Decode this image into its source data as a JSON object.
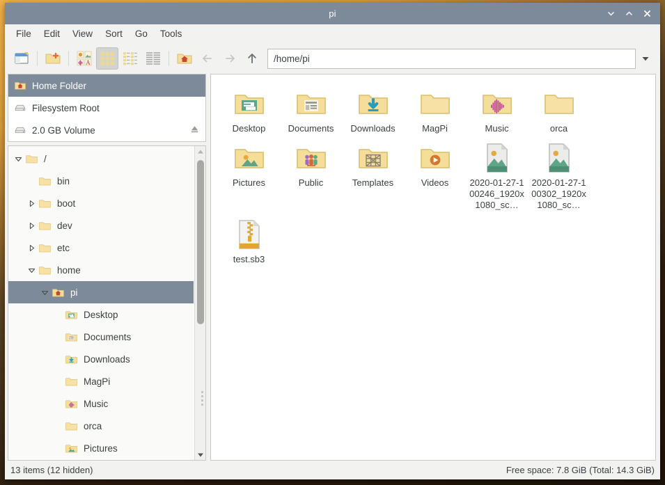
{
  "window": {
    "title": "pi",
    "buttons": [
      {
        "name": "minimize",
        "glyph": "chevron-down"
      },
      {
        "name": "maximize",
        "glyph": "chevron-up"
      },
      {
        "name": "close",
        "glyph": "x"
      }
    ]
  },
  "menubar": {
    "items": [
      "File",
      "Edit",
      "View",
      "Sort",
      "Go",
      "Tools"
    ]
  },
  "toolbar": {
    "buttons": [
      {
        "name": "new-tab-button",
        "icon": "new-tab-icon",
        "active": false
      },
      {
        "name": "new-folder-button",
        "icon": "new-folder-icon",
        "active": false
      },
      {
        "name": "view-icons-thumbnail-button",
        "icon": "thumbnail-view-icon",
        "active": false
      },
      {
        "name": "view-icons-button",
        "icon": "icon-view-icon",
        "active": true
      },
      {
        "name": "view-compact-button",
        "icon": "compact-view-icon",
        "active": false
      },
      {
        "name": "view-detailed-button",
        "icon": "detailed-view-icon",
        "active": false
      },
      {
        "name": "home-button",
        "icon": "home-folder-icon",
        "active": false
      }
    ],
    "nav": [
      {
        "name": "back-button",
        "icon": "arrow-left-icon",
        "enabled": false
      },
      {
        "name": "forward-button",
        "icon": "arrow-right-icon",
        "enabled": false
      },
      {
        "name": "up-button",
        "icon": "arrow-up-icon",
        "enabled": true
      }
    ],
    "path_value": "/home/pi",
    "path_placeholder": "",
    "path_dropdown_icon": "triangle-down-icon"
  },
  "sidebar": {
    "places": [
      {
        "label": "Home Folder",
        "icon": "home-folder-icon",
        "selected": true,
        "eject": false
      },
      {
        "label": "Filesystem Root",
        "icon": "drive-icon",
        "selected": false,
        "eject": false
      },
      {
        "label": "2.0 GB Volume",
        "icon": "drive-icon",
        "selected": false,
        "eject": true
      }
    ],
    "tree": [
      {
        "label": "/",
        "icon": "folder-icon",
        "indent": 0,
        "expander": "expanded",
        "selected": false
      },
      {
        "label": "bin",
        "icon": "folder-icon",
        "indent": 1,
        "expander": "none",
        "selected": false
      },
      {
        "label": "boot",
        "icon": "folder-icon",
        "indent": 1,
        "expander": "collapsed",
        "selected": false
      },
      {
        "label": "dev",
        "icon": "folder-icon",
        "indent": 1,
        "expander": "collapsed",
        "selected": false
      },
      {
        "label": "etc",
        "icon": "folder-icon",
        "indent": 1,
        "expander": "collapsed",
        "selected": false
      },
      {
        "label": "home",
        "icon": "folder-icon",
        "indent": 1,
        "expander": "expanded",
        "selected": false
      },
      {
        "label": "pi",
        "icon": "home-folder-icon",
        "indent": 2,
        "expander": "expanded",
        "selected": true
      },
      {
        "label": "Desktop",
        "icon": "folder-desktop-icon",
        "indent": 3,
        "expander": "none",
        "selected": false
      },
      {
        "label": "Documents",
        "icon": "folder-documents-icon",
        "indent": 3,
        "expander": "none",
        "selected": false
      },
      {
        "label": "Downloads",
        "icon": "folder-downloads-icon",
        "indent": 3,
        "expander": "none",
        "selected": false
      },
      {
        "label": "MagPi",
        "icon": "folder-icon",
        "indent": 3,
        "expander": "none",
        "selected": false
      },
      {
        "label": "Music",
        "icon": "folder-music-icon",
        "indent": 3,
        "expander": "none",
        "selected": false
      },
      {
        "label": "orca",
        "icon": "folder-icon",
        "indent": 3,
        "expander": "none",
        "selected": false
      },
      {
        "label": "Pictures",
        "icon": "folder-pictures-icon",
        "indent": 3,
        "expander": "none",
        "selected": false
      }
    ],
    "scrollbar": {
      "up_icon": "scroll-up-icon",
      "down_icon": "scroll-down-icon"
    }
  },
  "files": [
    {
      "label": "Desktop",
      "icon": "folder-desktop-icon"
    },
    {
      "label": "Documents",
      "icon": "folder-documents-icon"
    },
    {
      "label": "Downloads",
      "icon": "folder-downloads-icon"
    },
    {
      "label": "MagPi",
      "icon": "folder-icon"
    },
    {
      "label": "Music",
      "icon": "folder-music-icon"
    },
    {
      "label": "orca",
      "icon": "folder-icon"
    },
    {
      "label": "Pictures",
      "icon": "folder-pictures-icon"
    },
    {
      "label": "Public",
      "icon": "folder-public-icon"
    },
    {
      "label": "Templates",
      "icon": "folder-templates-icon"
    },
    {
      "label": "Videos",
      "icon": "folder-videos-icon"
    },
    {
      "label": "2020-01-27-100246_1920x1080_sc…",
      "icon": "image-file-icon"
    },
    {
      "label": "2020-01-27-100302_1920x1080_sc…",
      "icon": "image-file-icon"
    },
    {
      "label": "test.sb3",
      "icon": "archive-file-icon"
    }
  ],
  "statusbar": {
    "left": "13 items (12 hidden)",
    "right": "Free space: 7.8 GiB (Total: 14.3 GiB)"
  },
  "colors": {
    "titlebar": "#7d8a99",
    "selection": "#7d8a99",
    "window_bg": "#f2f2f0",
    "folder": "#f5dd9a",
    "text": "#3c4043"
  }
}
